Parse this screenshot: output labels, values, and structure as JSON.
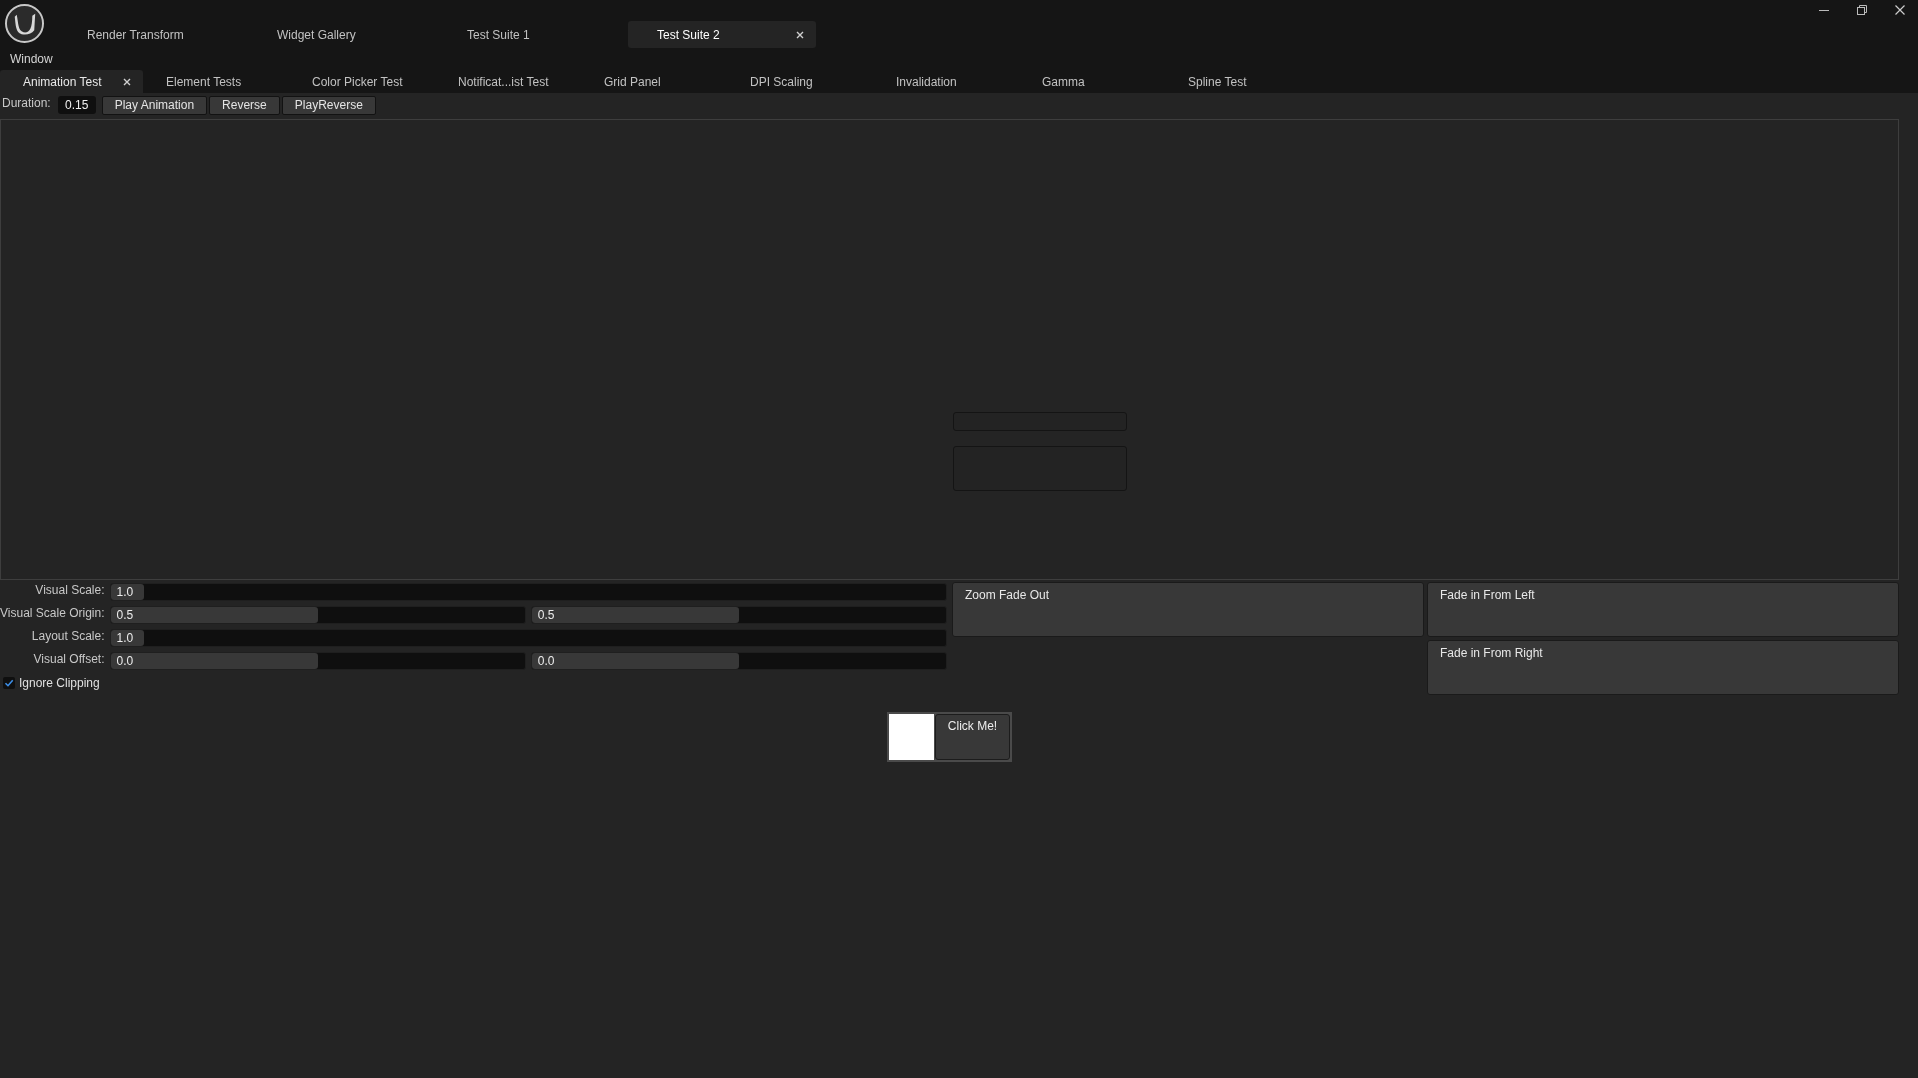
{
  "window": {
    "menu": "Window"
  },
  "app_tabs": [
    {
      "label": "Render Transform",
      "selected": false
    },
    {
      "label": "Widget Gallery",
      "selected": false
    },
    {
      "label": "Test Suite 1",
      "selected": false
    },
    {
      "label": "Test Suite 2",
      "selected": true
    }
  ],
  "doc_tabs": [
    {
      "label": "Animation Test",
      "selected": true
    },
    {
      "label": "Element Tests",
      "selected": false
    },
    {
      "label": "Color Picker Test",
      "selected": false
    },
    {
      "label": "Notificat...ist Test",
      "selected": false
    },
    {
      "label": "Grid Panel",
      "selected": false
    },
    {
      "label": "DPI Scaling",
      "selected": false
    },
    {
      "label": "Invalidation",
      "selected": false
    },
    {
      "label": "Gamma",
      "selected": false
    },
    {
      "label": "Spline Test",
      "selected": false
    }
  ],
  "toolbar": {
    "duration_label": "Duration:",
    "duration_value": "0.15",
    "buttons": [
      "Play Animation",
      "Reverse",
      "PlayReverse"
    ]
  },
  "properties": [
    {
      "label": "Visual Scale:",
      "fields": [
        {
          "value": "1.0",
          "level": 0.04
        }
      ]
    },
    {
      "label": "Visual Scale Origin:",
      "fields": [
        {
          "value": "0.5",
          "level": 0.5
        },
        {
          "value": "0.5",
          "level": 0.5
        }
      ]
    },
    {
      "label": "Layout Scale:",
      "fields": [
        {
          "value": "1.0",
          "level": 0.04
        }
      ]
    },
    {
      "label": "Visual Offset:",
      "fields": [
        {
          "value": "0.0",
          "level": 0.5
        },
        {
          "value": "0.0",
          "level": 0.5
        }
      ]
    }
  ],
  "ignore_clipping": {
    "label": "Ignore Clipping",
    "checked": true
  },
  "animation_buttons": [
    [
      "Zoom Fade Out"
    ],
    [
      "Fade in From Left",
      "Fade in From Right"
    ]
  ],
  "click_button": {
    "label": "Click Me!"
  }
}
